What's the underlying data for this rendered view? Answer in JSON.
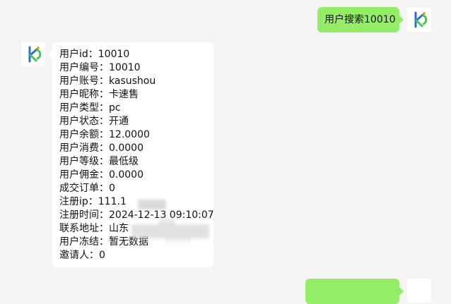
{
  "messages": {
    "outgoing_top": {
      "text": "用户搜索10010"
    },
    "reply": {
      "lines": [
        "用户id：10010",
        "用户编号：10010",
        "用户账号：kasushou",
        "用户昵称：卡速售",
        "用户类型：pc",
        "用户状态：开通",
        "用户余额：12.0000",
        "用户消费：0.0000",
        "用户等级：最低级",
        "用户佣金：0.0000",
        "成交订单：0",
        "注册ip：111.1",
        "注册时间：2024-12-13 09:10:07",
        "联系地址：山东",
        "用户冻结：暂无数据",
        "邀请人：0"
      ]
    }
  },
  "colors": {
    "outgoing_bubble": "#95ec69",
    "incoming_bubble": "#ffffff",
    "background": "#f5f5f5"
  },
  "icons": {
    "user_avatar": "kasushou-logo-icon",
    "bot_avatar": "kasushou-logo-icon"
  }
}
